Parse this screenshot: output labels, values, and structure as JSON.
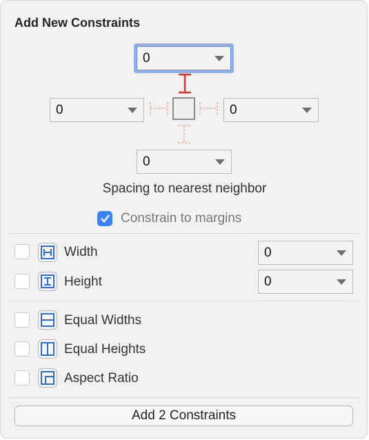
{
  "title": "Add New Constraints",
  "spacing": {
    "top": "0",
    "left": "0",
    "right": "0",
    "bottom": "0",
    "caption": "Spacing to nearest neighbor"
  },
  "constrain_to_margins": {
    "label": "Constrain to margins",
    "checked": true
  },
  "size": [
    {
      "label": "Width",
      "value": "0",
      "checked": false,
      "icon": "width-constraint-icon"
    },
    {
      "label": "Height",
      "value": "0",
      "checked": false,
      "icon": "height-constraint-icon"
    }
  ],
  "relations": [
    {
      "label": "Equal Widths",
      "checked": false,
      "icon": "equal-widths-icon"
    },
    {
      "label": "Equal Heights",
      "checked": false,
      "icon": "equal-heights-icon"
    },
    {
      "label": "Aspect Ratio",
      "checked": false,
      "icon": "aspect-ratio-icon"
    }
  ],
  "add_button": "Add 2 Constraints",
  "colors": {
    "accent": "#3a82f7",
    "active_constraint": "#e8322b",
    "inactive_constraint": "#f0aaa0",
    "focus_ring": "#8eaeed"
  }
}
